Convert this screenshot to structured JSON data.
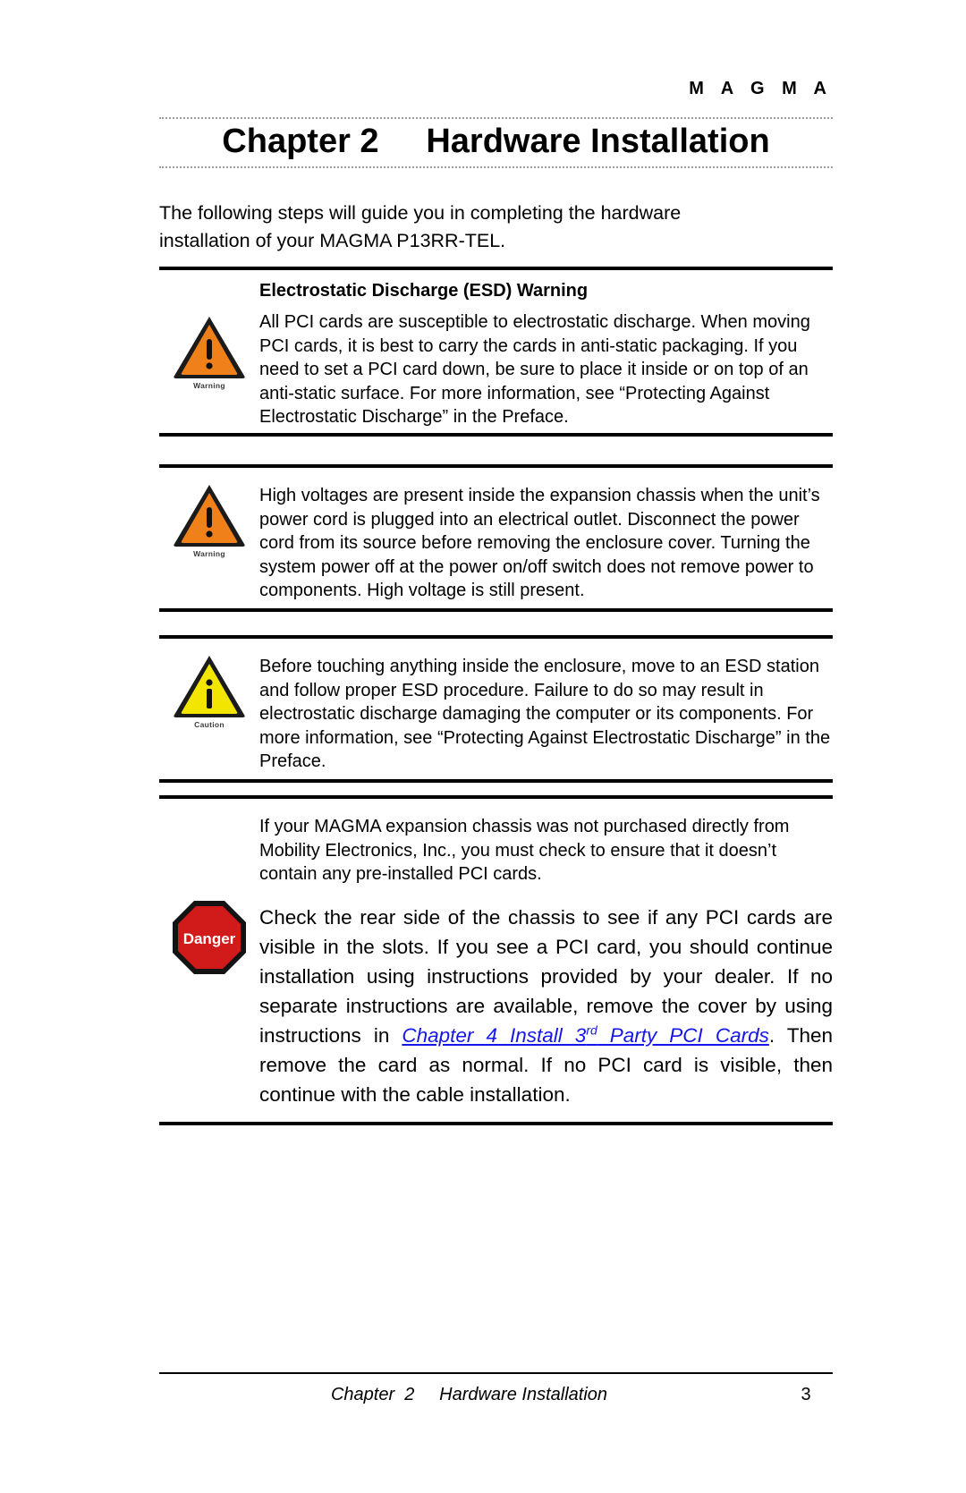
{
  "header": {
    "brand": "M A G M A"
  },
  "title": {
    "chapter_label": "Chapter 2",
    "chapter_name": "Hardware Installation",
    "full": "Chapter 2     Hardware Installation"
  },
  "intro": {
    "line1": "The following steps will guide you in completing the hardware",
    "line2": "installation of your MAGMA P13RR-TEL."
  },
  "blocks": [
    {
      "id": "esd",
      "heading": "Electrostatic Discharge (ESD) Warning",
      "icon": "warning-triangle-icon",
      "icon_caption": "Warning",
      "icon_color": "#F08019",
      "text": "All PCI cards are susceptible to electrostatic discharge.  When moving PCI cards, it is best to carry the cards in anti-static packaging.  If you need to set a PCI card down, be sure to place it inside or on top of an anti-static surface.  For more information, see “Protecting Against Electrostatic Discharge” in the Preface."
    },
    {
      "id": "voltage",
      "heading": "",
      "icon": "warning-triangle-icon",
      "icon_caption": "Warning",
      "icon_color": "#F08019",
      "text": "High voltages are present inside the expansion chassis when the unit’s power cord is plugged into an electrical outlet. Disconnect the power cord from its source before removing the enclosure cover.  Turning the system power off at the power on/off switch does not remove power to components.  High voltage is still present."
    },
    {
      "id": "caution",
      "heading": "",
      "icon": "caution-info-triangle-icon",
      "icon_caption": "Caution",
      "icon_color": "#F2E500",
      "text": "Before touching anything inside the enclosure, move to an ESD station and follow proper ESD procedure.  Failure to do so may result in electrostatic discharge damaging the computer or its components.  For more information, see “Protecting Against Electrostatic Discharge” in the Preface."
    }
  ],
  "danger": {
    "icon": "danger-octagon-icon",
    "icon_label": "Danger",
    "icon_color": "#D11A1A",
    "paragraph1": "If your MAGMA expansion chassis was not purchased directly from Mobility Electronics, Inc., you must check to ensure that it doesn’t contain any pre-installed PCI cards.",
    "paragraph2_part1": "Check the rear side of the chassis to see if any PCI cards are visible in the slots. If you see a PCI card, you should continue installation using instructions provided by your dealer. If no separate instructions are available, remove the cover by using instructions in ",
    "link_text_before_sup": "Chapter 4 Install 3",
    "link_sup": "rd",
    "link_text_after_sup": " Party PCI Cards",
    "paragraph2_part2": ". Then remove the card as normal. If no PCI card is visible, then continue with the cable installation."
  },
  "footer": {
    "center": "Chapter  2     Hardware Installation",
    "page_number": "3"
  },
  "colors": {
    "link": "#1417E8",
    "warning_orange": "#F08019",
    "caution_yellow": "#F2E500",
    "danger_red": "#D11A1A",
    "rule": "#000000",
    "dotted_rule": "#9A9A9A"
  }
}
